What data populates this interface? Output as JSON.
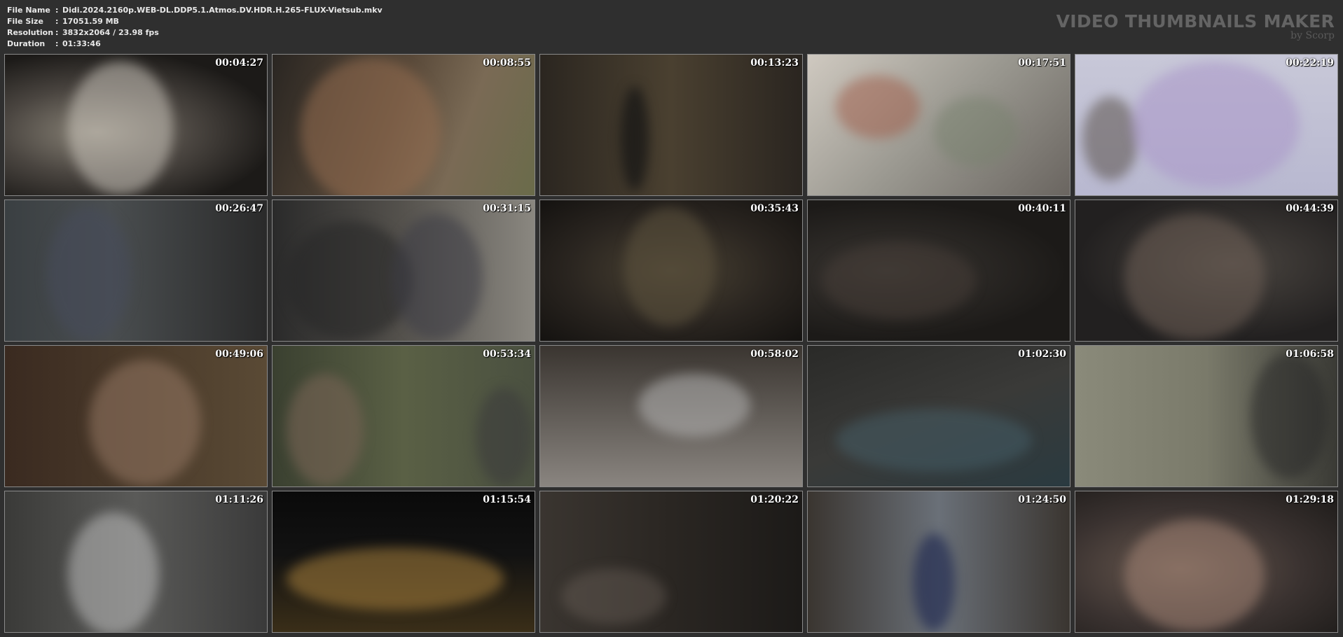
{
  "info": {
    "rows": [
      {
        "label": "File Name",
        "sep": ":",
        "value": "Didi.2024.2160p.WEB-DL.DDP5.1.Atmos.DV.HDR.H.265-FLUX-Vietsub.mkv"
      },
      {
        "label": "File Size",
        "sep": ":",
        "value": "17051.59 MB"
      },
      {
        "label": "Resolution",
        "sep": ":",
        "value": "3832x2064 / 23.98 fps"
      },
      {
        "label": "Duration",
        "sep": ":",
        "value": "01:33:46"
      }
    ]
  },
  "brand": {
    "title": "VIDEO THUMBNAILS MAKER",
    "subtitle": "by Scorp"
  },
  "thumbnails": [
    {
      "time": "00:04:27"
    },
    {
      "time": "00:08:55"
    },
    {
      "time": "00:13:23"
    },
    {
      "time": "00:17:51"
    },
    {
      "time": "00:22:19"
    },
    {
      "time": "00:26:47"
    },
    {
      "time": "00:31:15"
    },
    {
      "time": "00:35:43"
    },
    {
      "time": "00:40:11"
    },
    {
      "time": "00:44:39"
    },
    {
      "time": "00:49:06"
    },
    {
      "time": "00:53:34"
    },
    {
      "time": "00:58:02"
    },
    {
      "time": "01:02:30"
    },
    {
      "time": "01:06:58"
    },
    {
      "time": "01:11:26"
    },
    {
      "time": "01:15:54"
    },
    {
      "time": "01:20:22"
    },
    {
      "time": "01:24:50"
    },
    {
      "time": "01:29:18"
    }
  ]
}
